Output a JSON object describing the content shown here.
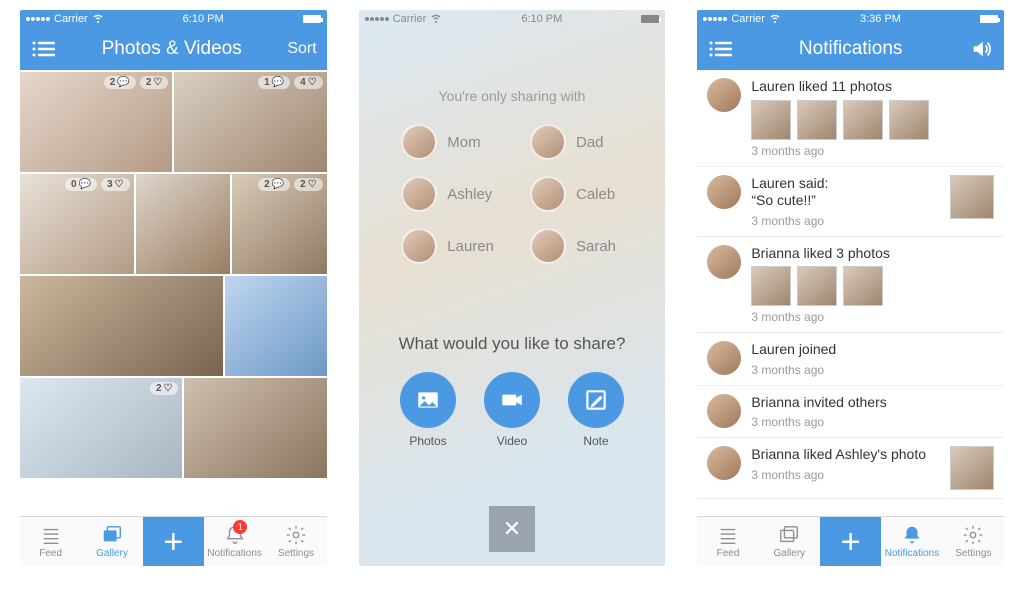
{
  "status": {
    "carrier": "Carrier",
    "time1": "6:10 PM",
    "time2": "6:10 PM",
    "time3": "3:36 PM"
  },
  "screen1": {
    "title": "Photos & Videos",
    "sort": "Sort",
    "cells": [
      {
        "comments": "2",
        "likes": "2"
      },
      {
        "comments": "1",
        "likes": "4"
      },
      {
        "comments": "0",
        "likes": "3"
      },
      {
        "comments": "2",
        "likes": "2"
      },
      {
        "comments": null,
        "likes": "2"
      }
    ]
  },
  "tabs": {
    "feed": "Feed",
    "gallery": "Gallery",
    "notifications": "Notifications",
    "settings": "Settings",
    "badge": "1"
  },
  "screen2": {
    "sharing_with": "You're only sharing with",
    "people": [
      "Mom",
      "Dad",
      "Ashley",
      "Caleb",
      "Lauren",
      "Sarah"
    ],
    "prompt": "What would you like to share?",
    "actions": {
      "photos": "Photos",
      "video": "Video",
      "note": "Note"
    }
  },
  "screen3": {
    "title": "Notifications",
    "items": [
      {
        "title": "Lauren liked 11 photos",
        "meta": "3 months ago",
        "thumbs": 4
      },
      {
        "title": "Lauren said:\n“So cute!!”",
        "meta": "3 months ago",
        "side": true
      },
      {
        "title": "Brianna liked 3 photos",
        "meta": "3 months ago",
        "thumbs": 3
      },
      {
        "title": "Lauren joined",
        "meta": "3 months ago"
      },
      {
        "title": "Brianna invited others",
        "meta": "3 months ago"
      },
      {
        "title": "Brianna liked Ashley's photo",
        "meta": "3 months ago",
        "side": true
      }
    ]
  }
}
